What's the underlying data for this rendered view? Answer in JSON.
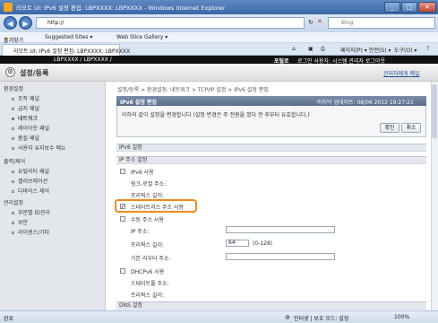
{
  "window": {
    "title": "리모트 UI: IPv6 설정 편집: LBPXXXX: LBPXXXX - Windows Internet Explorer",
    "minimize": "_",
    "maximize": "□",
    "close": "✕"
  },
  "addressbar": {
    "url": "http://",
    "search_placeholder": "Bing"
  },
  "favorites": {
    "label": "즐겨찾기",
    "items": [
      "Suggested Sites ▾",
      "Web Slice Gallery ▾"
    ]
  },
  "tab": {
    "title": "리모트 UI: IPv6 설정 편집: LBPXXXX: LBPXXXX"
  },
  "commandbar": {
    "page": "페이지(P) ▾",
    "safety": "안전(S) ▾",
    "tools": "도구(O) ▾",
    "help": "?"
  },
  "topbar": {
    "device": "LBPXXXX / LBPXXXX /",
    "login_info": "로그인 사용자: 시스템 관리자 로그아웃",
    "portal": "포털로"
  },
  "header": {
    "title": "설정/등록",
    "mail": "관리자에게 메일"
  },
  "sidebar": {
    "sections": [
      {
        "title": "환경설정",
        "items": [
          "조작 패널",
          "급지 패널",
          "네트워크",
          "레이아웃 패널",
          "품질 패널",
          "사용자 유지보수 메뉴"
        ]
      },
      {
        "title": "출력/제어",
        "items": [
          "유틸리티 패널",
          "캘리브레이션",
          "디바이스 제어"
        ]
      },
      {
        "title": "관리설정",
        "items": [
          "부문별 ID관리",
          "보안",
          "라이센스/기타"
        ]
      }
    ],
    "active": "네트워크"
  },
  "breadcrumb": "설정/등록 > 환경설정: 네트워크 > TCP/IP 설정 > IPv6 설정 편집",
  "panel": {
    "title": "IPv6 설정 편집",
    "updated": "마지막 업데이트: 08/06 2012 19:27:21",
    "message": "이하의 같이 설정을 변경합니다 (설정 변경은 주 전원을 껐다 켠 후부터 유효합니다.)",
    "ok": "확인",
    "cancel": "취소"
  },
  "form": {
    "section_ipv6": "IPv6 설정",
    "section_ipaddr": "IP 주소 설정",
    "use_ipv6": "IPv6 사용",
    "link_local": "링크-로컬 주소:",
    "prefix_len_label": "프리픽스 길이:",
    "stateless": "스테이트리스 주소 사용",
    "manual": "수동 주소 사용",
    "ip_address": "IP 주소:",
    "prefix_len": "프리픽스 길이:",
    "prefix_value": "64",
    "prefix_range": "(0-128)",
    "default_router": "기본 라우터 주소:",
    "dhcpv6": "DHCPv6 사용",
    "stateful": "스테이트풀 주소:",
    "prefix_len2": "프리픽스 길이:",
    "dns_section": "DNS 설정"
  },
  "status": {
    "left": "완료",
    "zone": "인터넷 | 보호 모드: 설정",
    "zoom": "100%"
  }
}
